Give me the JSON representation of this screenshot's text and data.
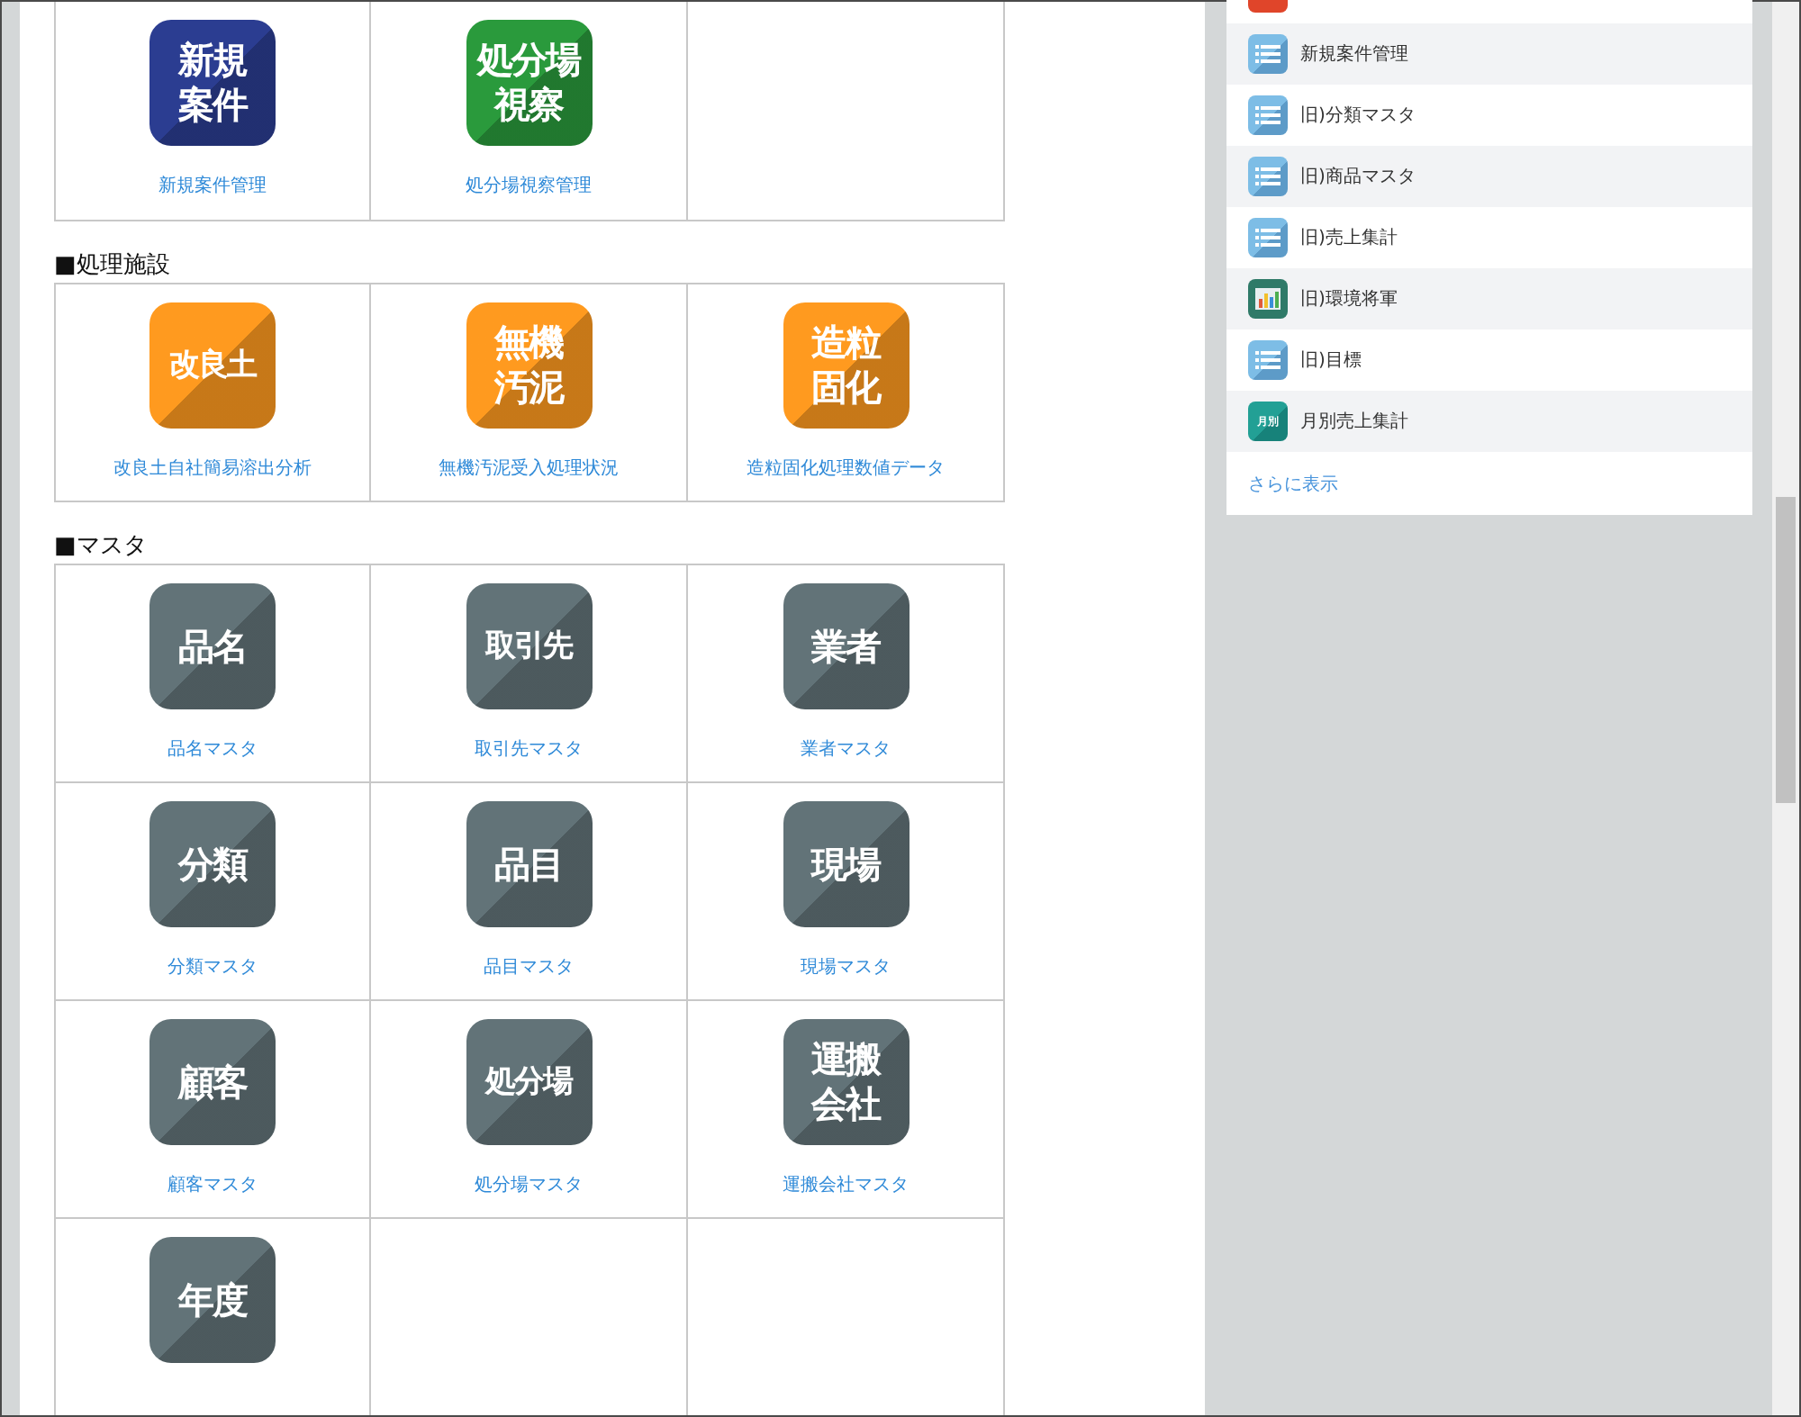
{
  "sections": [
    {
      "tiles": [
        {
          "icon_lines": [
            "新規",
            "案件"
          ],
          "color": "#2b3d91",
          "label": "新規案件管理"
        },
        {
          "icon_lines": [
            "処分場",
            "視察"
          ],
          "color": "#2a9a3c",
          "label": "処分場視察管理"
        }
      ]
    },
    {
      "heading": "■処理施設",
      "tiles": [
        {
          "icon_lines": [
            "改良土"
          ],
          "color": "#ff9a1f",
          "label": "改良土自社簡易溶出分析"
        },
        {
          "icon_lines": [
            "無機",
            "汚泥"
          ],
          "color": "#ff9a1f",
          "label": "無機汚泥受入処理状況"
        },
        {
          "icon_lines": [
            "造粒",
            "固化"
          ],
          "color": "#ff9a1f",
          "label": "造粒固化処理数値データ"
        }
      ]
    },
    {
      "heading": "■マスタ",
      "tiles": [
        {
          "icon_lines": [
            "品名"
          ],
          "color": "#627378",
          "label": "品名マスタ"
        },
        {
          "icon_lines": [
            "取引先"
          ],
          "color": "#627378",
          "label": "取引先マスタ"
        },
        {
          "icon_lines": [
            "業者"
          ],
          "color": "#627378",
          "label": "業者マスタ"
        },
        {
          "icon_lines": [
            "分類"
          ],
          "color": "#627378",
          "label": "分類マスタ"
        },
        {
          "icon_lines": [
            "品目"
          ],
          "color": "#627378",
          "label": "品目マスタ"
        },
        {
          "icon_lines": [
            "現場"
          ],
          "color": "#627378",
          "label": "現場マスタ"
        },
        {
          "icon_lines": [
            "顧客"
          ],
          "color": "#627378",
          "label": "顧客マスタ"
        },
        {
          "icon_lines": [
            "処分場"
          ],
          "color": "#627378",
          "label": "処分場マスタ"
        },
        {
          "icon_lines": [
            "運搬",
            "会社"
          ],
          "color": "#627378",
          "label": "運搬会社マスタ"
        },
        {
          "icon_lines": [
            "年度"
          ],
          "color": "#627378"
        }
      ]
    }
  ],
  "sidebar": {
    "items": [
      {
        "kind": "list",
        "label": "新規案件管理"
      },
      {
        "kind": "list",
        "label": "旧)分類マスタ"
      },
      {
        "kind": "list",
        "label": "旧)商品マスタ"
      },
      {
        "kind": "list",
        "label": "旧)売上集計"
      },
      {
        "kind": "chart",
        "label": "旧)環境将軍"
      },
      {
        "kind": "list",
        "label": "旧)目標"
      },
      {
        "kind": "text",
        "icon_text": "月別",
        "label": "月別売上集計"
      }
    ],
    "more_link": "さらに表示"
  }
}
